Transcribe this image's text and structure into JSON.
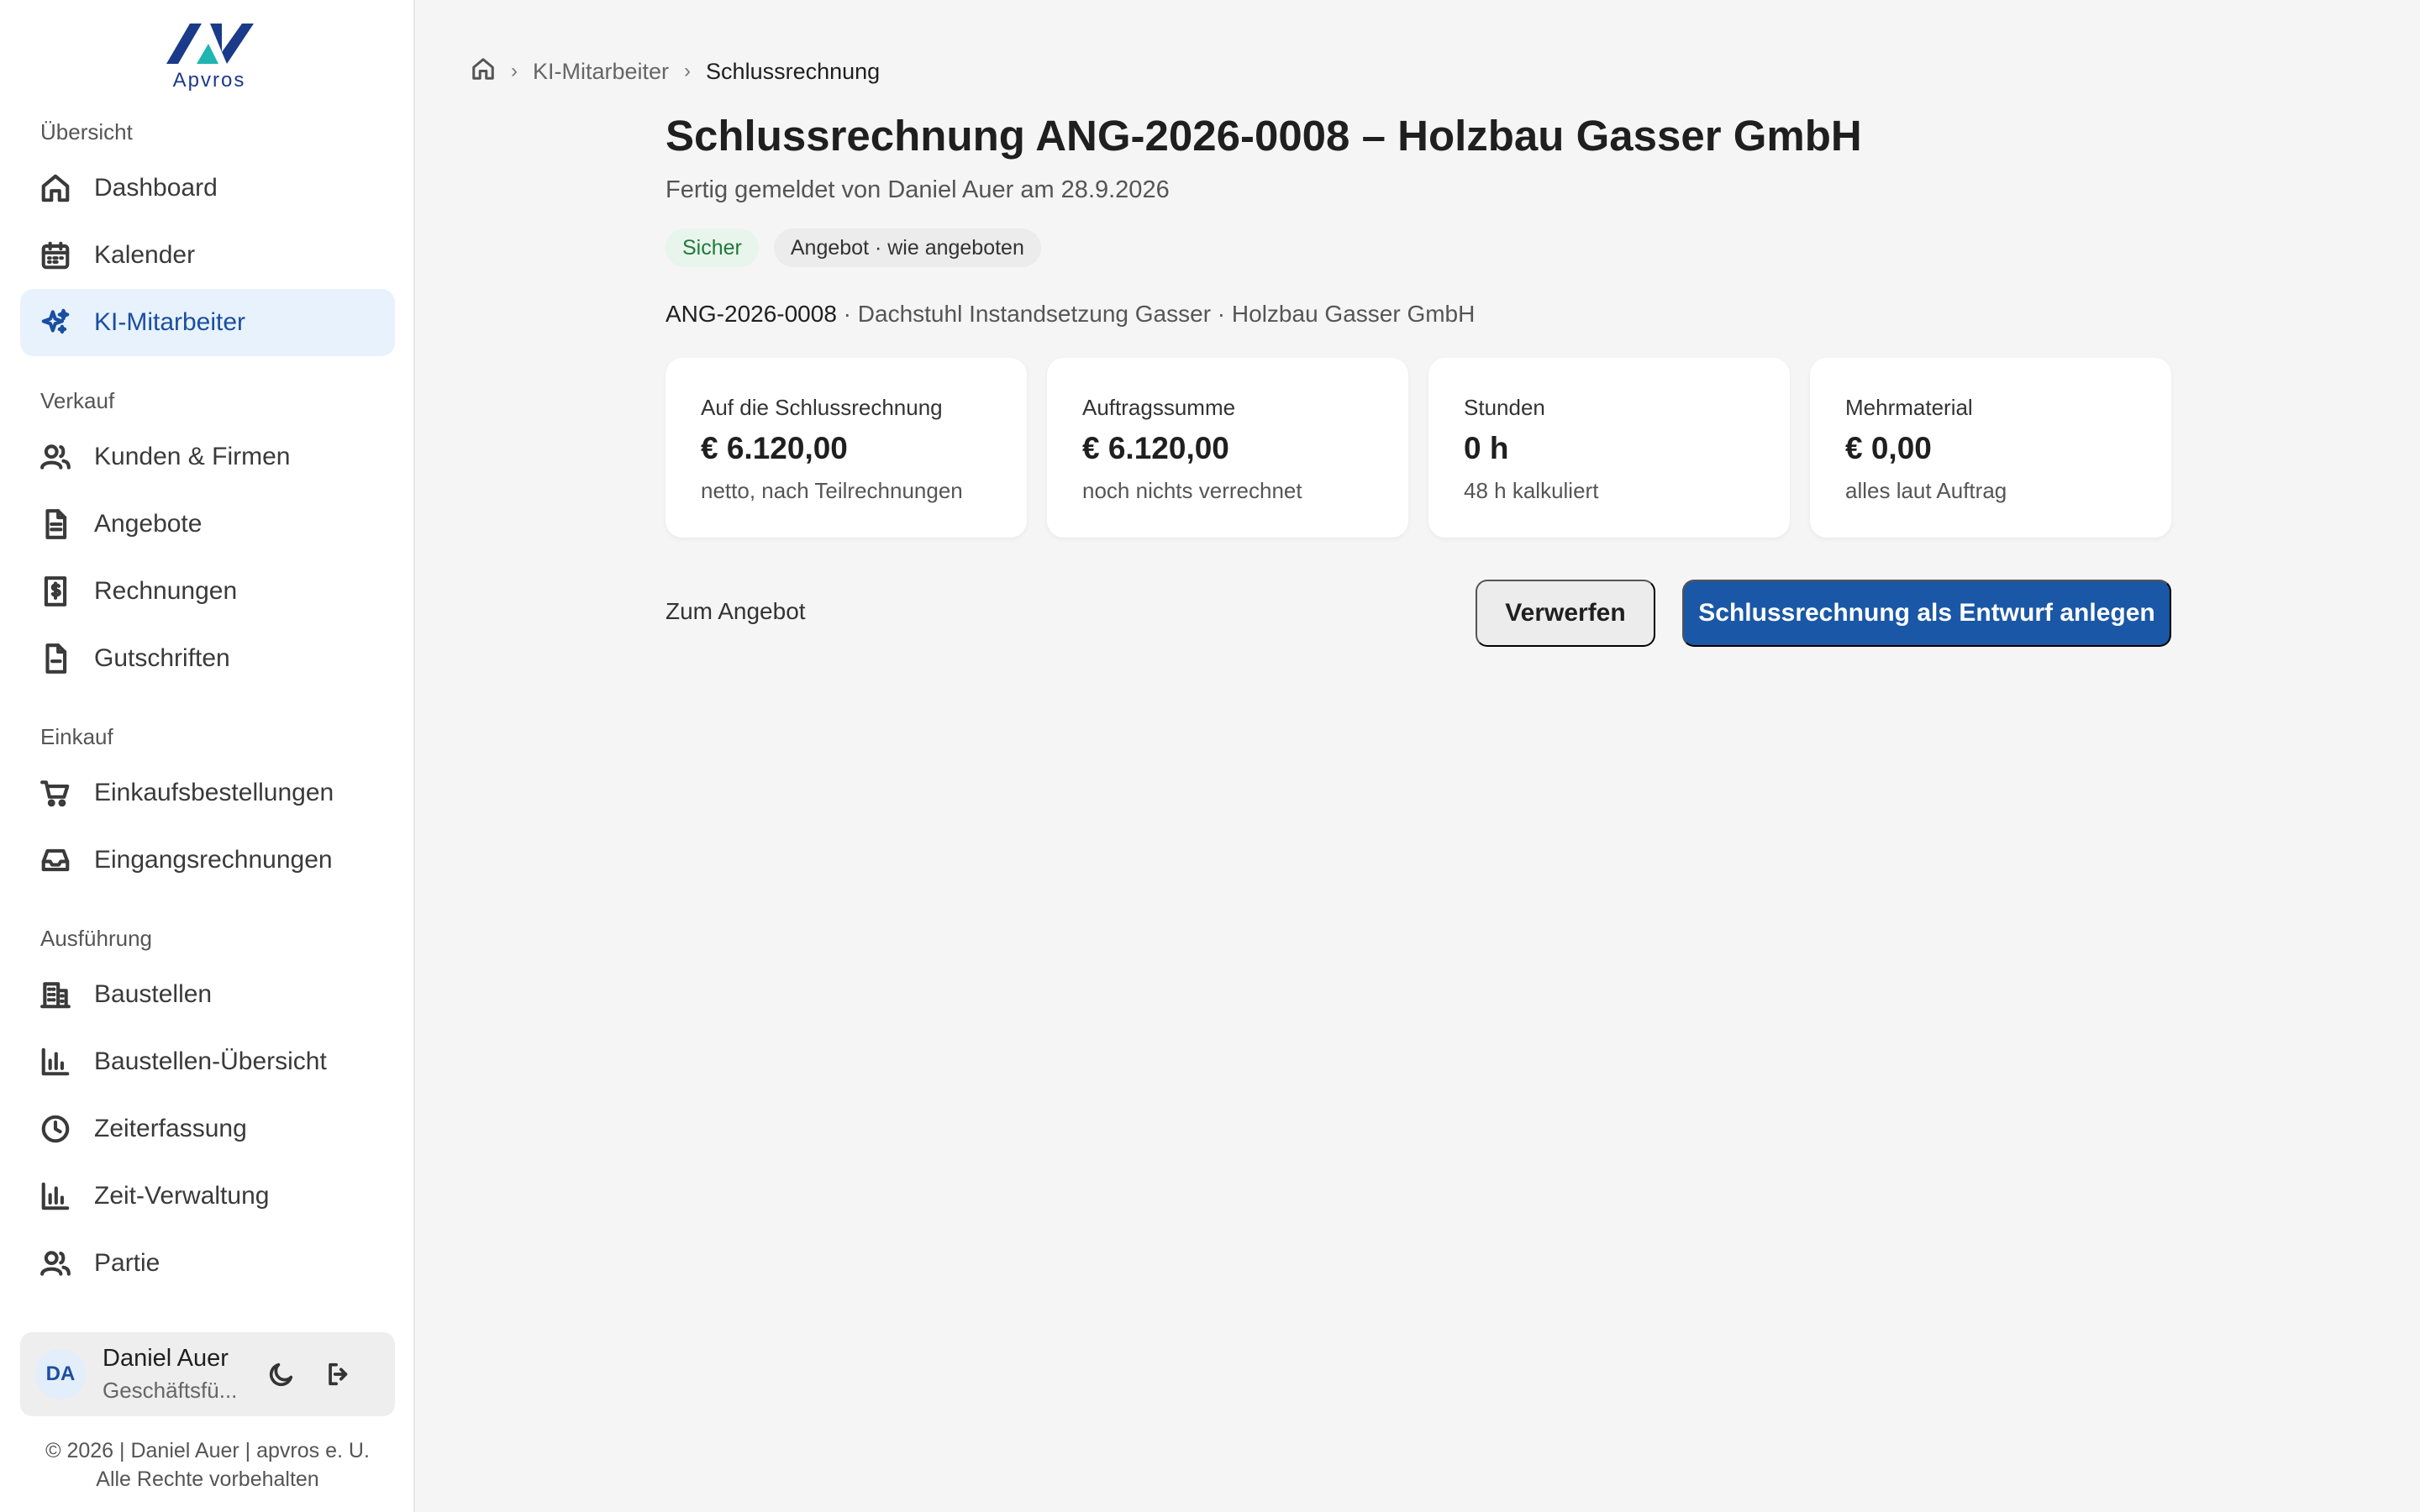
{
  "brand": {
    "name": "Apvros",
    "colors": {
      "primary": "#1a57a6",
      "active_bg": "#e8f2fd",
      "logo_navy": "#1b3a8a",
      "logo_teal": "#1fb5b0"
    }
  },
  "sidebar": {
    "sections": [
      {
        "label": "Übersicht"
      },
      {
        "label": "Verkauf"
      },
      {
        "label": "Einkauf"
      },
      {
        "label": "Ausführung"
      }
    ],
    "items": [
      {
        "label": "Dashboard",
        "icon": "home-icon"
      },
      {
        "label": "Kalender",
        "icon": "calendar-icon"
      },
      {
        "label": "KI-Mitarbeiter",
        "icon": "sparkles-icon",
        "active": true
      },
      {
        "label": "Kunden & Firmen",
        "icon": "users-icon"
      },
      {
        "label": "Angebote",
        "icon": "document-icon"
      },
      {
        "label": "Rechnungen",
        "icon": "invoice-dollar-icon"
      },
      {
        "label": "Gutschriften",
        "icon": "credit-note-icon"
      },
      {
        "label": "Einkaufsbestellungen",
        "icon": "cart-icon"
      },
      {
        "label": "Eingangsrechnungen",
        "icon": "inbox-icon"
      },
      {
        "label": "Baustellen",
        "icon": "building-icon"
      },
      {
        "label": "Baustellen-Übersicht",
        "icon": "bar-chart-icon"
      },
      {
        "label": "Zeiterfassung",
        "icon": "clock-icon"
      },
      {
        "label": "Zeit-Verwaltung",
        "icon": "bar-chart-icon"
      },
      {
        "label": "Partie",
        "icon": "users-icon"
      }
    ]
  },
  "user": {
    "initials": "DA",
    "name": "Daniel Auer",
    "role": "Geschäftsfü..."
  },
  "footer": {
    "line1": "© 2026 | Daniel Auer | apvros e. U.",
    "line2": "Alle Rechte vorbehalten"
  },
  "breadcrumb": {
    "parent": "KI-Mitarbeiter",
    "current": "Schlussrechnung"
  },
  "header": {
    "title": "Schlussrechnung ANG-2026-0008 – Holzbau Gasser GmbH",
    "subtitle": "Fertig gemeldet von Daniel Auer am 28.9.2026",
    "badges": [
      {
        "label": "Sicher",
        "tone": "green"
      },
      {
        "label": "Angebot · wie angeboten",
        "tone": "grey"
      }
    ]
  },
  "reference": {
    "id": "ANG-2026-0008",
    "rest": " · Dachstuhl Instandsetzung Gasser · Holzbau Gasser GmbH"
  },
  "cards": [
    {
      "label": "Auf die Schlussrechnung",
      "value": "€ 6.120,00",
      "note": "netto, nach Teilrechnungen"
    },
    {
      "label": "Auftragssumme",
      "value": "€ 6.120,00",
      "note": "noch nichts verrechnet"
    },
    {
      "label": "Stunden",
      "value": "0 h",
      "note": "48 h kalkuliert"
    },
    {
      "label": "Mehrmaterial",
      "value": "€ 0,00",
      "note": "alles laut Auftrag"
    }
  ],
  "actions": {
    "link_label": "Zum Angebot",
    "discard_label": "Verwerfen",
    "primary_label": "Schlussrechnung als Entwurf anlegen"
  }
}
